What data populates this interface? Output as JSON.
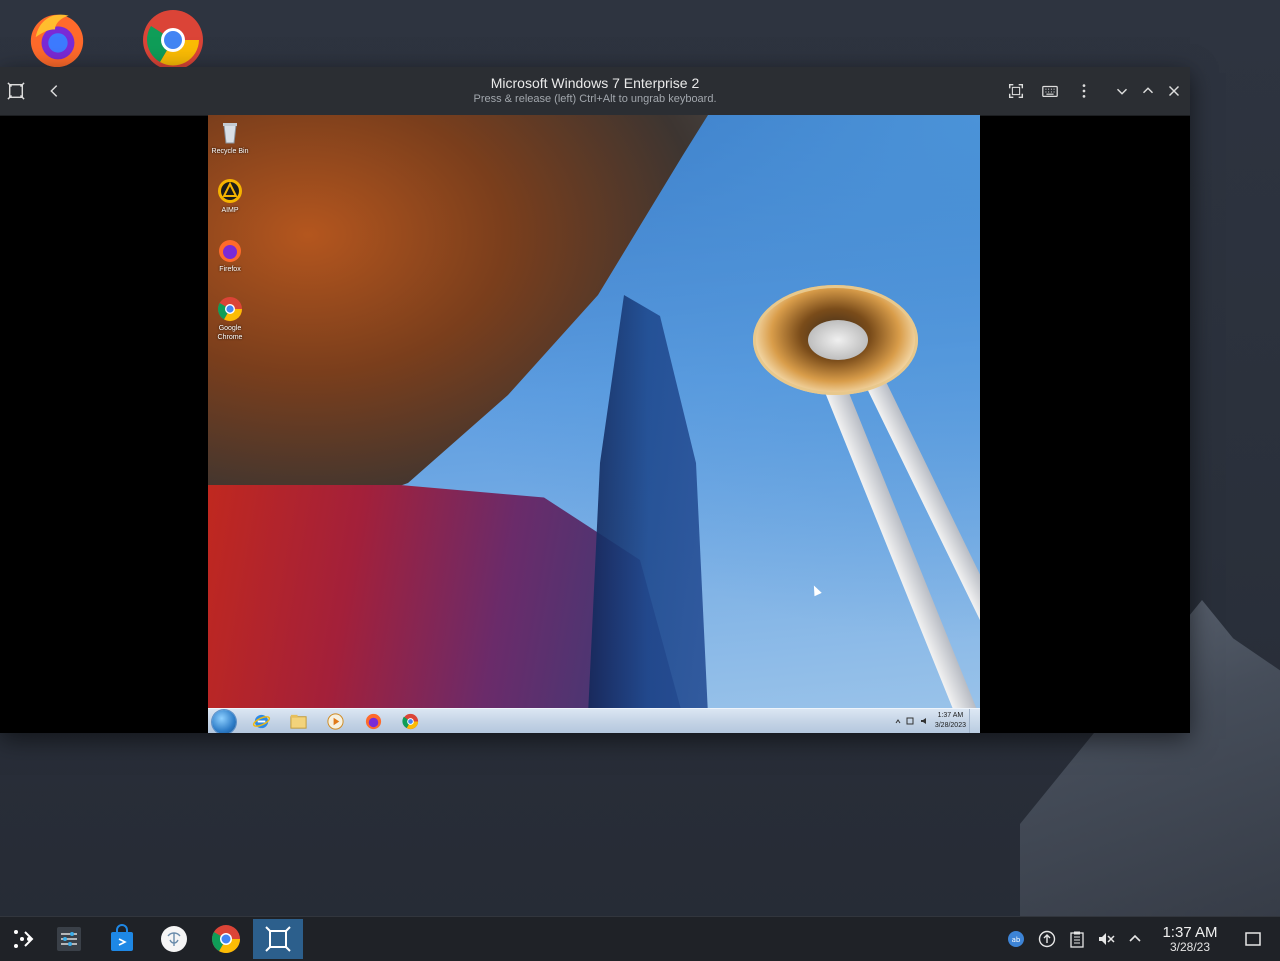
{
  "desktop": {
    "icons": [
      {
        "name": "firefox-icon"
      },
      {
        "name": "chrome-icon"
      }
    ]
  },
  "vm_window": {
    "title": "Microsoft Windows 7 Enterprise 2",
    "subtitle": "Press & release (left) Ctrl+Alt to ungrab keyboard.",
    "toolbar_icons": [
      "vm-app-icon",
      "back-icon",
      "fullscreen-icon",
      "send-key-icon",
      "menu-icon",
      "minimize-icon",
      "maximize-icon",
      "close-icon"
    ]
  },
  "guest": {
    "desktop_icons": [
      {
        "label": "Recycle Bin"
      },
      {
        "label": "AIMP"
      },
      {
        "label": "Firefox"
      },
      {
        "label": "Google Chrome"
      }
    ],
    "taskbar": {
      "time": "1:37 AM",
      "date": "3/28/2023"
    }
  },
  "panel": {
    "clock_time": "1:37 AM",
    "clock_date": "3/28/23",
    "accent": "#2c5f8c"
  }
}
